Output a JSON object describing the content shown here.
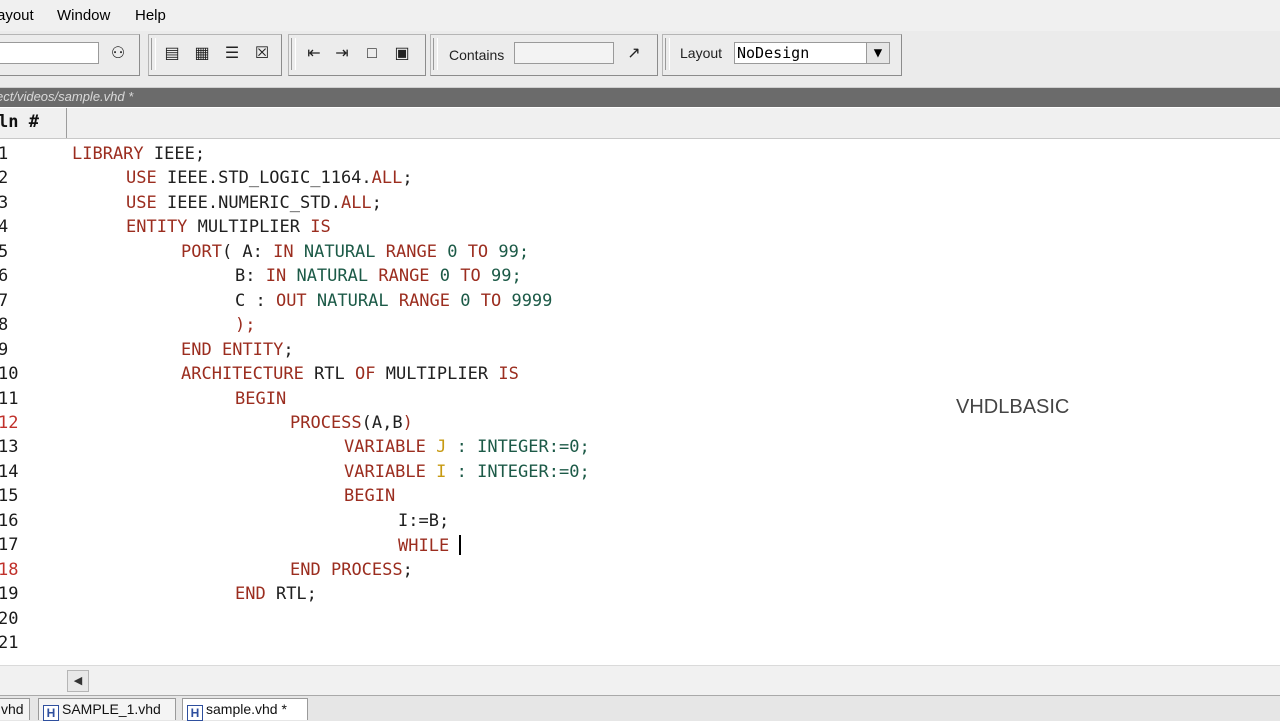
{
  "menubar": {
    "items": [
      "ayout",
      "Window",
      "Help"
    ]
  },
  "toolbar": {
    "contains_label": "Contains",
    "contains_value": "",
    "layout_label": "Layout",
    "layout_value": "NoDesign"
  },
  "path": {
    "text": "ect/videos/sample.vhd *"
  },
  "column_header": {
    "ln_label": "ln #"
  },
  "watermark": "VHDLBASIC",
  "editor": {
    "lines": [
      {
        "n": "1"
      },
      {
        "n": "2"
      },
      {
        "n": "3"
      },
      {
        "n": "4"
      },
      {
        "n": "5"
      },
      {
        "n": "6"
      },
      {
        "n": "7"
      },
      {
        "n": "8"
      },
      {
        "n": "9"
      },
      {
        "n": "10"
      },
      {
        "n": "11"
      },
      {
        "n": "12"
      },
      {
        "n": "13"
      },
      {
        "n": "14"
      },
      {
        "n": "15"
      },
      {
        "n": "16"
      },
      {
        "n": "17"
      },
      {
        "n": "18"
      },
      {
        "n": "19"
      },
      {
        "n": "20"
      },
      {
        "n": "21"
      }
    ],
    "tokens": {
      "l1": [
        "LIBRARY",
        " IEEE;"
      ],
      "l2": [
        "USE",
        " IEEE.STD_LOGIC_1164.",
        "ALL",
        ";"
      ],
      "l3": [
        "USE",
        " IEEE.NUMERIC_STD.",
        "ALL",
        ";"
      ],
      "l4": [
        "ENTITY",
        " MULTIPLIER ",
        "IS"
      ],
      "l5": [
        "PORT",
        "( A: ",
        "IN",
        " ",
        "NATURAL",
        " ",
        "RANGE",
        " 0 ",
        "TO",
        " 99;"
      ],
      "l6": [
        "B: ",
        "IN",
        " ",
        "NATURAL",
        " ",
        "RANGE",
        " 0 ",
        "TO",
        " 99;"
      ],
      "l7": [
        "C : ",
        "OUT",
        " ",
        "NATURAL",
        " ",
        "RANGE",
        " 0 ",
        "TO",
        " 9999"
      ],
      "l8": [
        ");"
      ],
      "l9": [
        "END",
        " ",
        "ENTITY",
        ";"
      ],
      "l10": [
        "ARCHITECTURE",
        " RTL ",
        "OF",
        " MULTIPLIER ",
        "IS"
      ],
      "l11": [
        "BEGIN"
      ],
      "l12": [
        "PROCESS",
        "(A,B",
        ")"
      ],
      "l13": [
        "VARIABLE",
        " J ",
        ": ",
        "INTEGER",
        ":=0;"
      ],
      "l14": [
        "VARIABLE",
        " I ",
        ": ",
        "INTEGER",
        ":=0;"
      ],
      "l15": [
        "BEGIN"
      ],
      "l16": [
        "I:=B;"
      ],
      "l17": [
        "WHILE",
        " "
      ],
      "l18": [
        "END",
        " ",
        "PROCESS",
        ";"
      ],
      "l19": [
        "END",
        " RTL;"
      ]
    }
  },
  "tabs": [
    {
      "label": "vhd"
    },
    {
      "label": "SAMPLE_1.vhd"
    },
    {
      "label": "sample.vhd *"
    }
  ],
  "colors": {
    "keyword": "#9b2d1f",
    "type": "#1c5a47",
    "variable": "#c79a12",
    "breakpoint_line_number": "#c0302a"
  }
}
